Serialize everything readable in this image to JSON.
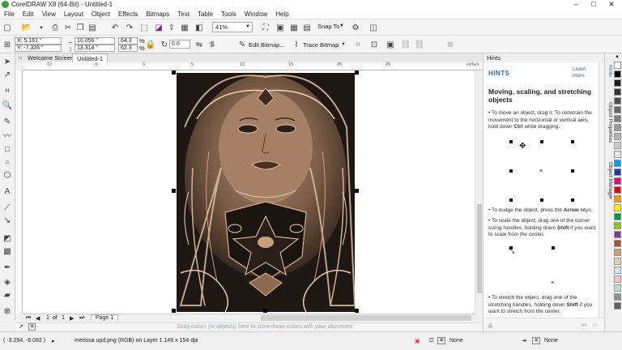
{
  "window": {
    "title": "CorelDRAW X8 (64-Bit) - Untitled-1",
    "controls": [
      "–",
      "□",
      "✕"
    ]
  },
  "menu": [
    "File",
    "Edit",
    "View",
    "Layout",
    "Object",
    "Effects",
    "Bitmaps",
    "Text",
    "Table",
    "Tools",
    "Window",
    "Help"
  ],
  "toolbar": {
    "zoom": "41%",
    "snap_to": "Snap To"
  },
  "propertybar": {
    "x": "X: 5.161 \"",
    "y": "Y: -7.326 \"",
    "width": "10.056 \"",
    "height": "13.314 \"",
    "scale_x": "64.3",
    "scale_y": "62.3",
    "percent": "%",
    "rotation": "0.0",
    "edit_bitmap": "Edit Bitmap...",
    "trace_bitmap": "Trace Bitmap"
  },
  "tabs": [
    "Welcome Screen",
    "Untitled-1"
  ],
  "ruler": {
    "h_labels": [
      "-10",
      "-5",
      "0",
      "5",
      "10",
      "15",
      "20",
      "25"
    ],
    "unit": "inches"
  },
  "pagenav": {
    "current": "1",
    "of": "of",
    "total": "1",
    "page_tab": "Page 1"
  },
  "palette_hint": "Drag colors (or objects) here to store these colors with your document",
  "status": {
    "coords": "( -3.254, -6.082 )",
    "object_info": "merissa upd.png (RGB) on Layer 1 149 x 154 dpi",
    "fill": "None",
    "outline": "None"
  },
  "docker": {
    "header": "Hints",
    "hints_title": "HINTS",
    "learn_more": "Learn more",
    "heading": "Moving, scaling, and stretching objects",
    "p1_pre": "• To move an object, drag it. To constrain the movement to the horizontal or vertical axis, hold down ",
    "p1_key": "Ctrl",
    "p1_post": " while dragging.",
    "p2_pre": "• To nudge the object, press the ",
    "p2_key": "Arrow",
    "p2_post": " keys.",
    "p3_pre": "• To scale the object, drag one of the corner sizing handles, holding down ",
    "p3_key": "Shift",
    "p3_post": " if you want to scale from the center.",
    "p4_pre": "• To stretch the object, drag one of the stretching handles, holding down ",
    "p4_key": "Shift",
    "p4_post": " if you want to stretch from the center."
  },
  "side_tabs": [
    "Hints",
    "Object Properties",
    "Object Manager"
  ],
  "palette_colors": [
    "#ffffff",
    "#000000",
    "#1a1a1a",
    "#333333",
    "#4d4d4d",
    "#666666",
    "#808080",
    "#999999",
    "#b3b3b3",
    "#cccccc",
    "#e6e6e6",
    "#00a0e9",
    "#1e3c96",
    "#e4007f",
    "#e60012",
    "#f39800",
    "#fff100",
    "#009944",
    "#8fc31f",
    "#7e3c96",
    "#a05a2c",
    "#c8a078",
    "#e0d0b0",
    "#d0e8f0",
    "#f4c0c0",
    "#c0e0c0",
    "#909090",
    "#606060"
  ]
}
